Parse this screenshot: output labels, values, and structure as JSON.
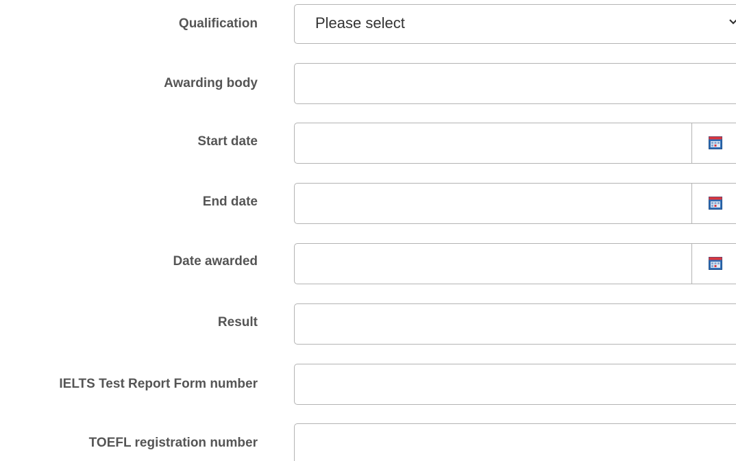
{
  "fields": {
    "qualification": {
      "label": "Qualification",
      "value": "Please select"
    },
    "awarding_body": {
      "label": "Awarding body",
      "value": ""
    },
    "start_date": {
      "label": "Start date",
      "value": "",
      "icon": "calendar-icon"
    },
    "end_date": {
      "label": "End date",
      "value": "",
      "icon": "calendar-icon"
    },
    "date_awarded": {
      "label": "Date awarded",
      "value": "",
      "icon": "calendar-icon"
    },
    "result": {
      "label": "Result",
      "value": ""
    },
    "ielts": {
      "label": "IELTS Test Report Form number",
      "value": ""
    },
    "toefl": {
      "label": "TOEFL registration number",
      "value": ""
    }
  },
  "colors": {
    "label": "#555555",
    "border": "#b3b3b3",
    "calendar_blue": "#2f6db5",
    "calendar_red": "#d9363e"
  }
}
